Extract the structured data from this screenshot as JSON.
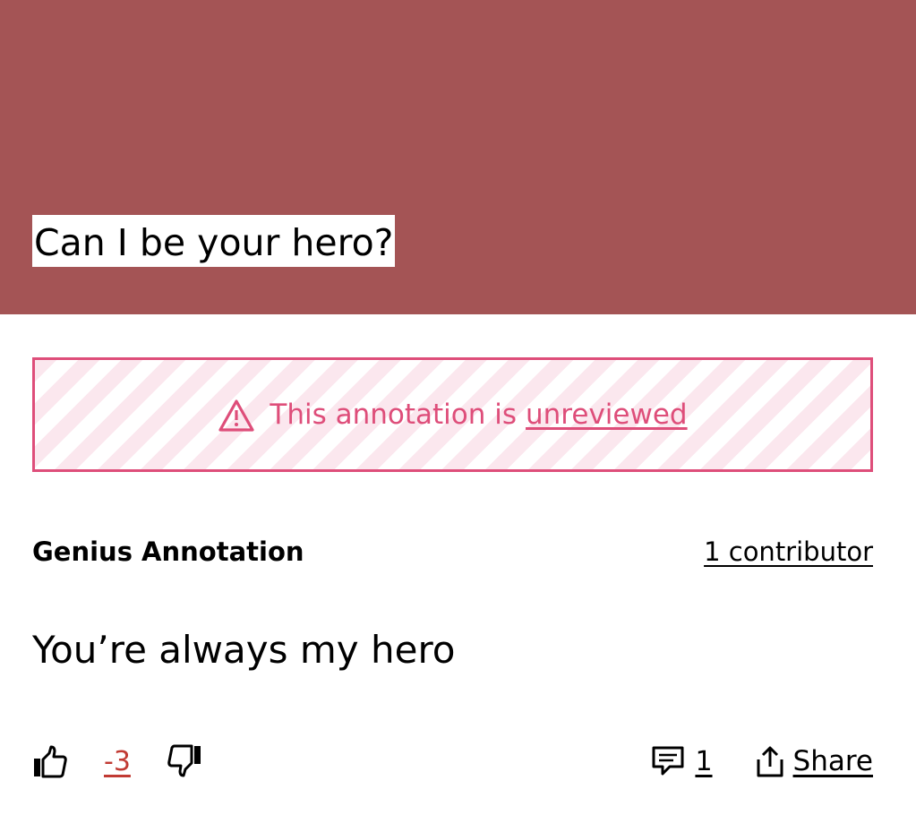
{
  "hero": {
    "title": "Can I be your hero?",
    "background_color": "#a45455"
  },
  "notice": {
    "icon": "warning-triangle-icon",
    "text": "This annotation is",
    "link_label": "unreviewed",
    "accent_color": "#de4e7a"
  },
  "annotation": {
    "source_label": "Genius Annotation",
    "contributors_label": "1 contributor",
    "body": "You’re always my hero"
  },
  "actions": {
    "upvote_icon": "thumbs-up-icon",
    "vote_count": "-3",
    "vote_count_color": "#c13a33",
    "downvote_icon": "thumbs-down-icon",
    "comment_icon": "comment-icon",
    "comment_count": "1",
    "share_icon": "share-icon",
    "share_label": "Share"
  }
}
